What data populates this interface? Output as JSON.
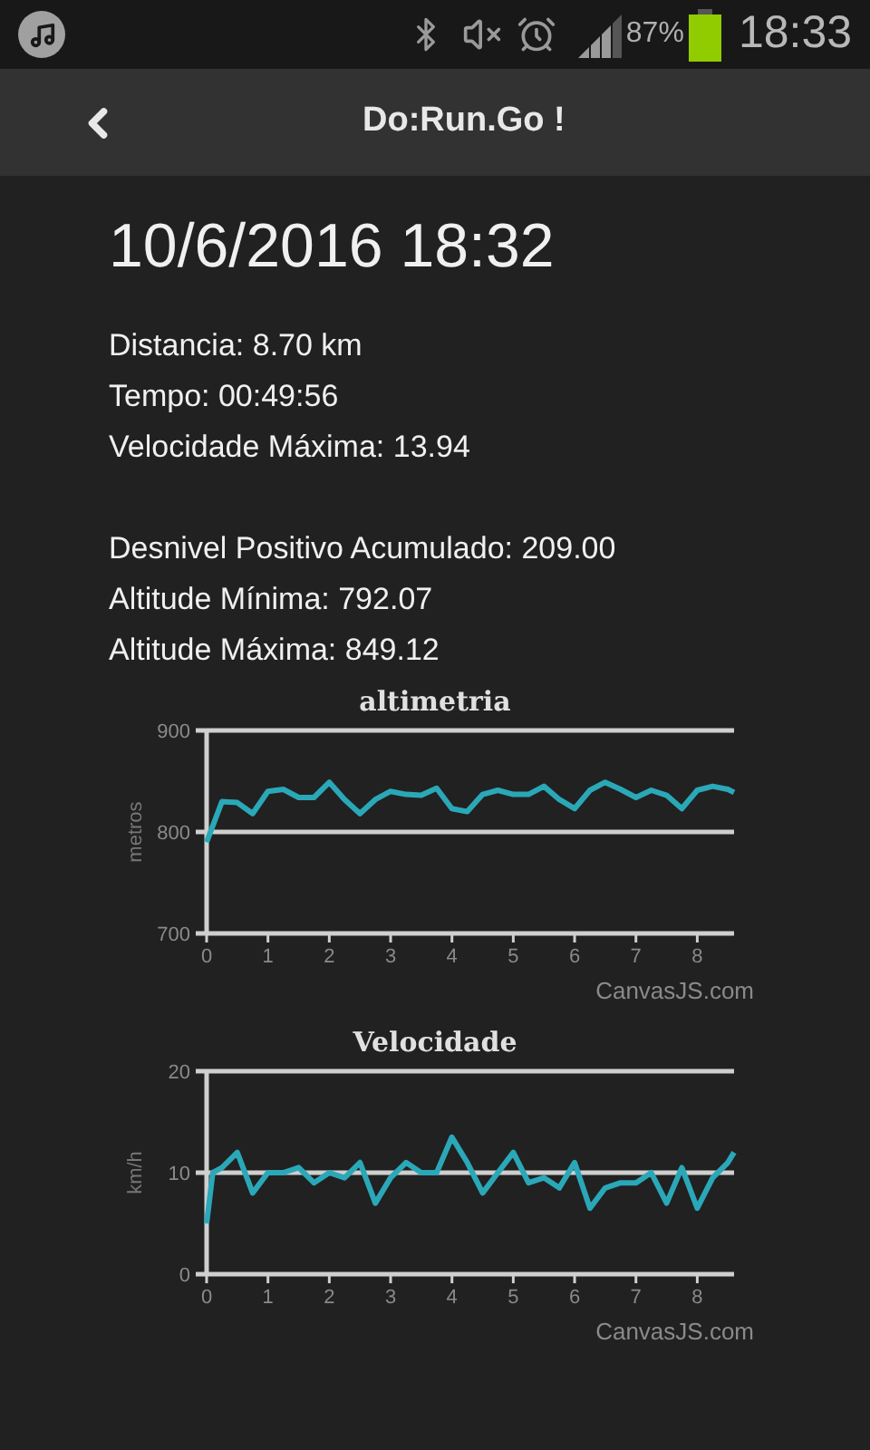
{
  "status_bar": {
    "battery_text": "87%",
    "time": "18:33"
  },
  "toolbar": {
    "title": "Do:Run.Go !"
  },
  "activity": {
    "datetime": "10/6/2016 18:32",
    "stats": [
      "Distancia: 8.70 km",
      "Tempo: 00:49:56",
      "Velocidade Máxima: 13.94"
    ],
    "stats_elevation": [
      "Desnivel Positivo Acumulado: 209.00",
      "Altitude Mínima: 792.07",
      "Altitude Máxima: 849.12"
    ]
  },
  "charts": [
    {
      "credit": "CanvasJS.com",
      "chart_data": {
        "type": "line",
        "title": "altimetria",
        "ylabel": "metros",
        "x": [
          0,
          0.25,
          0.5,
          0.75,
          1,
          1.25,
          1.5,
          1.75,
          2,
          2.25,
          2.5,
          2.75,
          3,
          3.25,
          3.5,
          3.75,
          4,
          4.25,
          4.5,
          4.75,
          5,
          5.25,
          5.5,
          5.75,
          6,
          6.25,
          6.5,
          6.75,
          7,
          7.25,
          7.5,
          7.75,
          8,
          8.25,
          8.5,
          8.6
        ],
        "series": [
          {
            "color": "#2aa8b8",
            "values": [
              790,
              830,
              829,
              818,
              840,
              842,
              834,
              834,
              849,
              832,
              818,
              832,
              840,
              837,
              836,
              843,
              823,
              820,
              837,
              841,
              837,
              837,
              845,
              832,
              823,
              841,
              849,
              842,
              834,
              841,
              836,
              823,
              841,
              845,
              842,
              839
            ]
          }
        ],
        "xlim": [
          0,
          8.6
        ],
        "ylim": [
          700,
          900
        ],
        "xticks": [
          0,
          1,
          2,
          3,
          4,
          5,
          6,
          7,
          8
        ],
        "yticks": [
          700,
          800,
          900
        ]
      }
    },
    {
      "credit": "CanvasJS.com",
      "chart_data": {
        "type": "line",
        "title": "Velocidade",
        "ylabel": "km/h",
        "x": [
          0,
          0.1,
          0.25,
          0.5,
          0.75,
          1,
          1.25,
          1.5,
          1.75,
          2,
          2.25,
          2.5,
          2.75,
          3,
          3.25,
          3.5,
          3.75,
          4,
          4.25,
          4.5,
          4.75,
          5,
          5.25,
          5.5,
          5.75,
          6,
          6.25,
          6.5,
          6.75,
          7,
          7.25,
          7.5,
          7.75,
          8,
          8.25,
          8.5,
          8.6
        ],
        "series": [
          {
            "color": "#2aa8b8",
            "values": [
              5,
              10,
              10.5,
              12,
              8,
              10,
              10,
              10.5,
              9,
              10,
              9.5,
              11,
              7,
              9.5,
              11,
              10,
              10,
              13.5,
              11,
              8,
              10,
              12,
              9,
              9.5,
              8.5,
              11,
              6.5,
              8.5,
              9,
              9,
              10,
              7,
              10.5,
              6.5,
              9.5,
              11,
              12
            ]
          }
        ],
        "xlim": [
          0,
          8.6
        ],
        "ylim": [
          0,
          20
        ],
        "xticks": [
          0,
          1,
          2,
          3,
          4,
          5,
          6,
          7,
          8
        ],
        "yticks": [
          0,
          10,
          20
        ]
      }
    }
  ]
}
